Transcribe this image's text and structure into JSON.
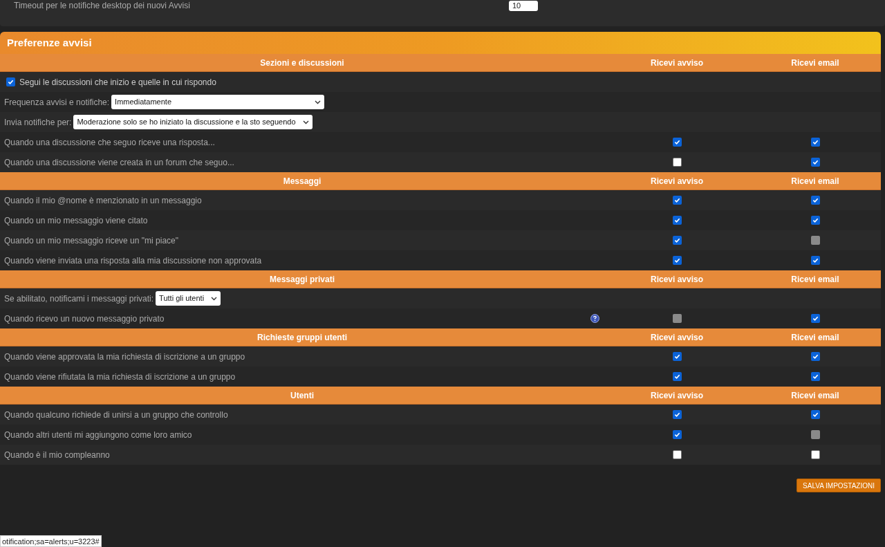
{
  "top_panel": {
    "label": "Timeout per le notifiche desktop dei nuovi Avvisi",
    "value": "10"
  },
  "panel_title": "Preferenze avvisi",
  "sections": [
    {
      "title": "Sezioni e discussioni",
      "col_alert": "Ricevi avviso",
      "col_email": "Ricevi email",
      "rows": [
        {
          "kind": "check",
          "label": "Segui le discussioni che inizio e quelle in cui rispondo",
          "checked": true
        },
        {
          "kind": "select",
          "label": "Frequenza avvisi e notifiche:",
          "value": "Immediatamente",
          "wide": true
        },
        {
          "kind": "select",
          "label": "Invia notifiche per:",
          "value": "Moderazione solo se ho iniziato la discussione e la sto seguendo",
          "wide": false
        },
        {
          "kind": "row",
          "label": "Quando una discussione che seguo riceve una risposta...",
          "help_icon": false,
          "alert": {
            "checked": true,
            "disabled": false
          },
          "email": {
            "checked": true,
            "disabled": false
          }
        },
        {
          "kind": "row",
          "label": "Quando una discussione viene creata in un forum che seguo...",
          "help_icon": false,
          "alert": {
            "checked": false,
            "disabled": false
          },
          "email": {
            "checked": true,
            "disabled": false
          }
        }
      ]
    },
    {
      "title": "Messaggi",
      "col_alert": "Ricevi avviso",
      "col_email": "Ricevi email",
      "rows": [
        {
          "kind": "row",
          "label": "Quando il mio @nome è menzionato in un messaggio",
          "help_icon": false,
          "alert": {
            "checked": true,
            "disabled": false
          },
          "email": {
            "checked": true,
            "disabled": false
          }
        },
        {
          "kind": "row",
          "label": "Quando un mio messaggio viene citato",
          "help_icon": false,
          "alert": {
            "checked": true,
            "disabled": false
          },
          "email": {
            "checked": true,
            "disabled": false
          }
        },
        {
          "kind": "row",
          "label": "Quando un mio messaggio riceve un \"mi piace\"",
          "help_icon": false,
          "alert": {
            "checked": true,
            "disabled": false
          },
          "email": {
            "checked": false,
            "disabled": true
          }
        },
        {
          "kind": "row",
          "label": "Quando viene inviata una risposta alla mia discussione non approvata",
          "help_icon": false,
          "alert": {
            "checked": true,
            "disabled": false
          },
          "email": {
            "checked": true,
            "disabled": false
          }
        }
      ]
    },
    {
      "title": "Messaggi privati",
      "col_alert": "Ricevi avviso",
      "col_email": "Ricevi email",
      "rows": [
        {
          "kind": "select",
          "label": "Se abilitato, notificami i messaggi privati:",
          "value": "Tutti gli utenti",
          "wide": false
        },
        {
          "kind": "row",
          "label": "Quando ricevo un nuovo messaggio privato",
          "help_icon": true,
          "alert": {
            "checked": false,
            "disabled": true
          },
          "email": {
            "checked": true,
            "disabled": false
          }
        }
      ]
    },
    {
      "title": "Richieste gruppi utenti",
      "col_alert": "Ricevi avviso",
      "col_email": "Ricevi email",
      "rows": [
        {
          "kind": "row",
          "label": "Quando viene approvata la mia richiesta di iscrizione a un gruppo",
          "help_icon": false,
          "alert": {
            "checked": true,
            "disabled": false
          },
          "email": {
            "checked": true,
            "disabled": false
          }
        },
        {
          "kind": "row",
          "label": "Quando viene rifiutata la mia richiesta di iscrizione a un gruppo",
          "help_icon": false,
          "alert": {
            "checked": true,
            "disabled": false
          },
          "email": {
            "checked": true,
            "disabled": false
          }
        }
      ]
    },
    {
      "title": "Utenti",
      "col_alert": "Ricevi avviso",
      "col_email": "Ricevi email",
      "rows": [
        {
          "kind": "row",
          "label": "Quando qualcuno richiede di unirsi a un gruppo che controllo",
          "help_icon": false,
          "alert": {
            "checked": true,
            "disabled": false
          },
          "email": {
            "checked": true,
            "disabled": false
          }
        },
        {
          "kind": "row",
          "label": "Quando altri utenti mi aggiungono come loro amico",
          "help_icon": false,
          "alert": {
            "checked": true,
            "disabled": false
          },
          "email": {
            "checked": false,
            "disabled": true
          }
        },
        {
          "kind": "row",
          "label": "Quando è il mio compleanno",
          "help_icon": false,
          "alert": {
            "checked": false,
            "disabled": false
          },
          "email": {
            "checked": false,
            "disabled": false
          }
        }
      ]
    }
  ],
  "save_button": "SALVA IMPOSTAZIONI",
  "status_url": "otification;sa=alerts;u=3223#"
}
